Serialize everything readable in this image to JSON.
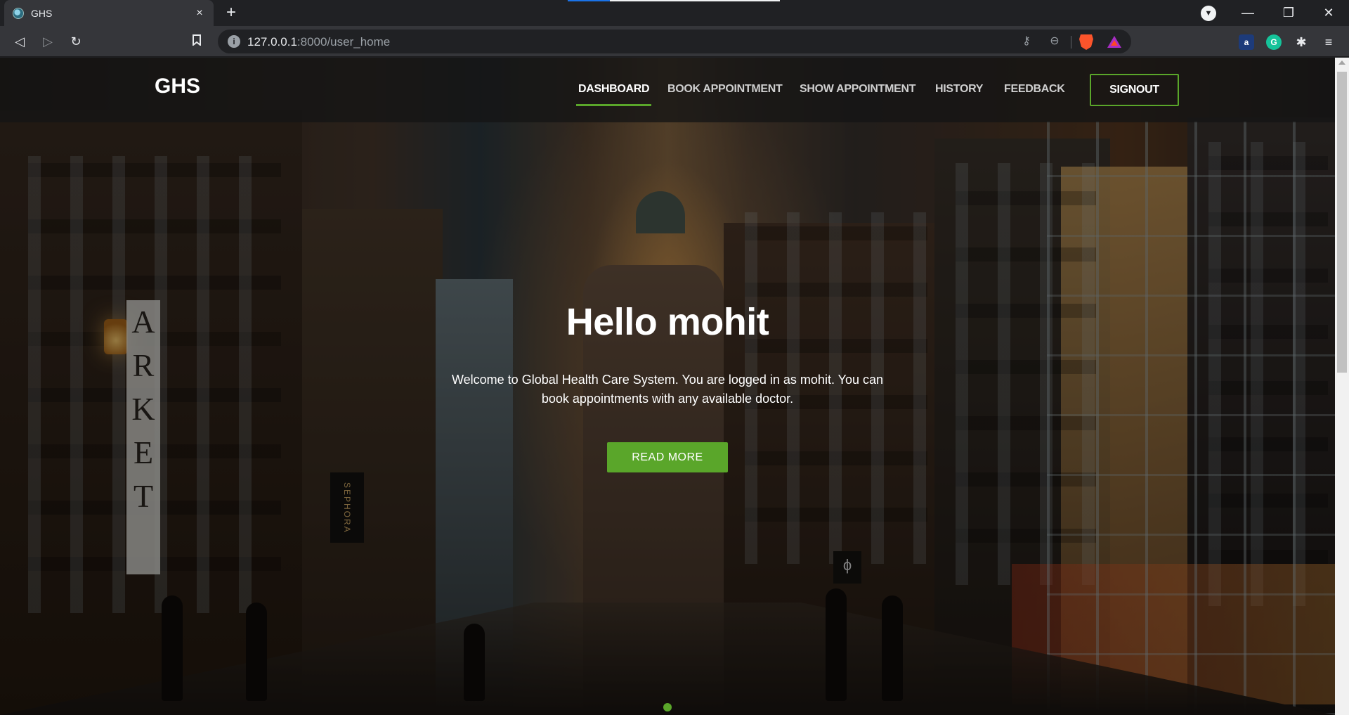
{
  "browser": {
    "tab_title": "GHS",
    "tab_close": "×",
    "new_tab": "+",
    "url_host": "127.0.0.1",
    "url_path": ":8000/user_home",
    "icons": [
      "back-icon",
      "forward-icon",
      "reload-icon",
      "bookmark-icon",
      "site-info-icon",
      "key-icon",
      "zoom-icon",
      "brave-shields-icon",
      "brave-rewards-icon",
      "extension-icon",
      "grammarly-icon",
      "puzzle-icon",
      "menu-icon"
    ],
    "window_controls": {
      "minimize": "—",
      "restore": "❐",
      "close": "✕"
    }
  },
  "site": {
    "brand": "GHS",
    "nav": [
      {
        "label": "DASHBOARD",
        "active": true
      },
      {
        "label": "BOOK APPOINTMENT",
        "active": false
      },
      {
        "label": "SHOW APPOINTMENT",
        "active": false
      },
      {
        "label": "HISTORY",
        "active": false
      },
      {
        "label": "FEEDBACK",
        "active": false
      }
    ],
    "signout_label": "SIGNOUT",
    "accent_color": "#5aa62a"
  },
  "hero": {
    "title": "Hello mohit",
    "text": "Welcome to Global Health Care System. You are logged in as mohit. You can book appointments with any available doctor.",
    "button_label": "READ MORE",
    "sign_arket": "ARKET",
    "sign_sephora": "SEPHORA",
    "sign_phi": "ϕ"
  }
}
